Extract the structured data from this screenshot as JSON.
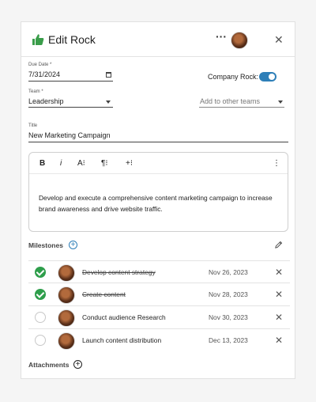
{
  "header": {
    "title": "Edit Rock",
    "more_label": "···",
    "close_label": "✕",
    "accent_color": "#3a9d4a"
  },
  "form": {
    "due_date": {
      "label": "Due Date *",
      "value": "7/31/2024"
    },
    "company_rock": {
      "label": "Company Rock:",
      "checked": true
    },
    "team": {
      "label": "Team *",
      "value": "Leadership"
    },
    "other_teams": {
      "placeholder": "Add to other teams"
    },
    "title": {
      "label": "Title",
      "value": "New Marketing Campaign"
    }
  },
  "editor": {
    "toolbar": {
      "bold": "B",
      "italic": "i",
      "font_size": "A⁝",
      "paragraph": "¶⁝",
      "insert": "+⁝",
      "more": "⋮"
    },
    "text": "Develop and execute a comprehensive content marketing campaign to increase brand awareness and drive website traffic."
  },
  "milestones": {
    "title": "Milestones",
    "add_label": "+",
    "items": [
      {
        "name": "Develop content strategy",
        "date": "Nov 26, 2023",
        "done": true
      },
      {
        "name": "Create content",
        "date": "Nov 28, 2023",
        "done": true
      },
      {
        "name": "Conduct audience Research",
        "date": "Nov 30, 2023",
        "done": false
      },
      {
        "name": "Launch content distribution",
        "date": "Dec 13, 2023",
        "done": false
      }
    ],
    "remove_label": "✕"
  },
  "attachments": {
    "title": "Attachments",
    "add_label": "+"
  },
  "colors": {
    "primary": "#2e7fb8",
    "done": "#2e9e4b"
  }
}
